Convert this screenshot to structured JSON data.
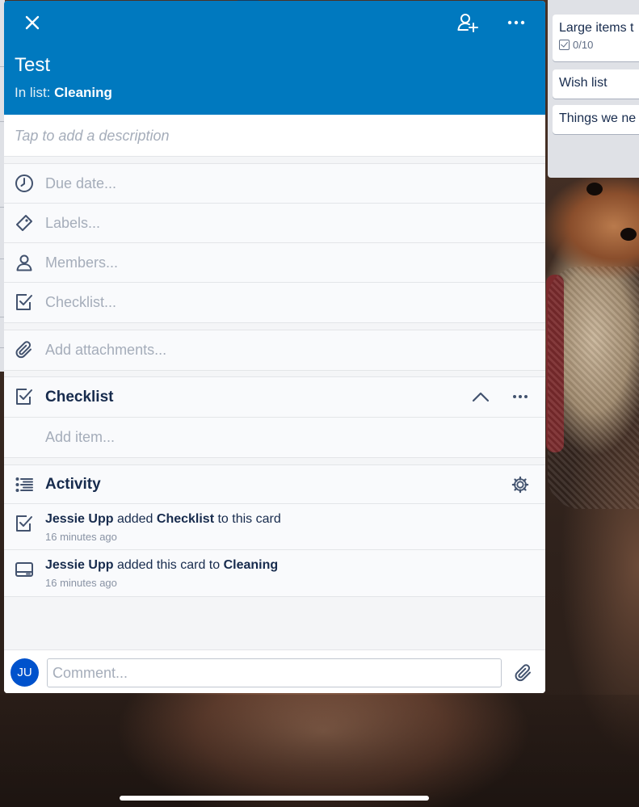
{
  "card": {
    "title": "Test",
    "in_list_prefix": "In list:",
    "list_name": "Cleaning",
    "description_placeholder": "Tap to add a description",
    "header_color": "#0079bf"
  },
  "header_icons": {
    "close": "close-icon",
    "add_member": "add-member-icon",
    "more": "more-icon"
  },
  "fields": {
    "due_date": "Due date...",
    "labels": "Labels...",
    "members": "Members...",
    "checklist": "Checklist...",
    "attachments": "Add attachments..."
  },
  "checklist_section": {
    "title": "Checklist",
    "add_item": "Add item..."
  },
  "activity": {
    "title": "Activity",
    "items": [
      {
        "user": "Jessie Upp",
        "verb": "added",
        "object": "Checklist",
        "suffix": "to this card",
        "time": "16 minutes ago",
        "icon": "checklist-icon"
      },
      {
        "user": "Jessie Upp",
        "verb": "added this card to",
        "object": "Cleaning",
        "time": "16 minutes ago",
        "icon": "card-icon"
      }
    ]
  },
  "comment": {
    "avatar_initials": "JU",
    "placeholder": "Comment..."
  },
  "right_list": {
    "cards": [
      {
        "title": "Large items t",
        "badge": "0/10"
      },
      {
        "title": "Wish list"
      },
      {
        "title": "Things we ne"
      }
    ]
  }
}
